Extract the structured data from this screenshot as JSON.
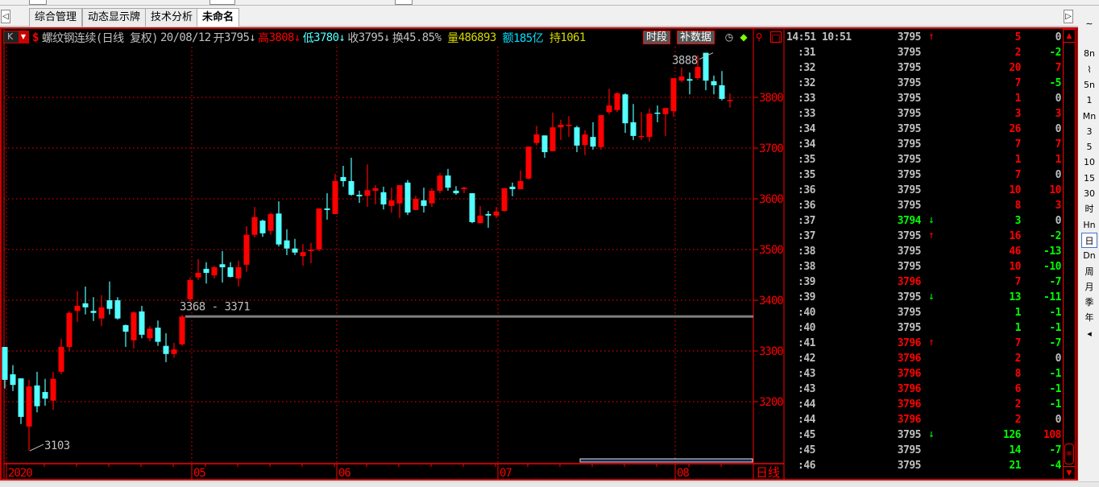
{
  "tabs": {
    "items": [
      {
        "label": "综合管理"
      },
      {
        "label": "动态显示牌"
      },
      {
        "label": "技术分析"
      },
      {
        "label": "未命名"
      }
    ],
    "active": 3
  },
  "header": {
    "period_button": "K",
    "name": "螺纹钢连续(日线 复权)",
    "date": "20/08/12",
    "open_label": "开",
    "open": "3795",
    "open_arrow": "↓",
    "high_label": "高",
    "high": "3808",
    "high_arrow": "↓",
    "low_label": "低",
    "low": "3780",
    "low_arrow": "↓",
    "close_label": "收",
    "close": "3795",
    "close_arrow": "↓",
    "turnover_label": "换",
    "turnover": "45.85%",
    "volume_label": "量",
    "volume": "486893",
    "amount_label": "额",
    "amount": "185亿",
    "oi_label": "持",
    "oi": "1061",
    "period_btn": "时段",
    "fill_btn": "补数据"
  },
  "colors": {
    "up": "#ff0000",
    "down": "#54ffff",
    "grid": "#ff0000",
    "green": "#00ff00",
    "text": "#c0c0c0"
  },
  "chart_data": {
    "type": "candlestick",
    "ylim": [
      3100,
      3900
    ],
    "yticks": [
      3200,
      3300,
      3400,
      3500,
      3600,
      3700,
      3800
    ],
    "period_label": "日线",
    "month_labels": [
      {
        "index": 0,
        "label": "2020"
      },
      {
        "index": 23,
        "label": "05"
      },
      {
        "index": 41,
        "label": "06"
      },
      {
        "index": 61,
        "label": "07"
      },
      {
        "index": 83,
        "label": "08"
      }
    ],
    "low_marker": {
      "index": 3,
      "value": 3103,
      "label": "3103"
    },
    "high_marker": {
      "index": 87,
      "value": 3888,
      "label": "3888"
    },
    "gap": {
      "from_index": 22,
      "low": 3368,
      "high": 3371,
      "label": "3368 - 3371"
    },
    "ohlc": [
      [
        3308,
        3308,
        3226,
        3243
      ],
      [
        3254,
        3272,
        3221,
        3233
      ],
      [
        3246,
        3246,
        3156,
        3170
      ],
      [
        3151,
        3243,
        3103,
        3230
      ],
      [
        3232,
        3259,
        3179,
        3191
      ],
      [
        3219,
        3245,
        3192,
        3206
      ],
      [
        3202,
        3259,
        3184,
        3245
      ],
      [
        3259,
        3324,
        3254,
        3308
      ],
      [
        3308,
        3378,
        3299,
        3375
      ],
      [
        3379,
        3418,
        3357,
        3389
      ],
      [
        3394,
        3427,
        3372,
        3386
      ],
      [
        3379,
        3406,
        3359,
        3375
      ],
      [
        3364,
        3410,
        3349,
        3386
      ],
      [
        3400,
        3437,
        3372,
        3383
      ],
      [
        3400,
        3406,
        3362,
        3364
      ],
      [
        3351,
        3352,
        3308,
        3338
      ],
      [
        3321,
        3378,
        3305,
        3376
      ],
      [
        3378,
        3389,
        3325,
        3332
      ],
      [
        3325,
        3349,
        3319,
        3344
      ],
      [
        3346,
        3360,
        3310,
        3318
      ],
      [
        3310,
        3335,
        3278,
        3294
      ],
      [
        3294,
        3316,
        3287,
        3303
      ],
      [
        3313,
        3371,
        3310,
        3368
      ],
      [
        3402,
        3445,
        3398,
        3440
      ],
      [
        3445,
        3481,
        3440,
        3454
      ],
      [
        3462,
        3475,
        3433,
        3454
      ],
      [
        3449,
        3468,
        3443,
        3465
      ],
      [
        3471,
        3497,
        3435,
        3465
      ],
      [
        3465,
        3475,
        3445,
        3446
      ],
      [
        3443,
        3478,
        3427,
        3465
      ],
      [
        3470,
        3546,
        3456,
        3529
      ],
      [
        3529,
        3584,
        3524,
        3564
      ],
      [
        3557,
        3559,
        3525,
        3532
      ],
      [
        3537,
        3573,
        3529,
        3570
      ],
      [
        3571,
        3595,
        3506,
        3510
      ],
      [
        3518,
        3540,
        3489,
        3502
      ],
      [
        3502,
        3521,
        3489,
        3494
      ],
      [
        3487,
        3511,
        3468,
        3495
      ],
      [
        3497,
        3513,
        3473,
        3500
      ],
      [
        3500,
        3581,
        3497,
        3581
      ],
      [
        3581,
        3611,
        3559,
        3578
      ],
      [
        3570,
        3649,
        3570,
        3635
      ],
      [
        3643,
        3665,
        3624,
        3635
      ],
      [
        3635,
        3681,
        3606,
        3608
      ],
      [
        3608,
        3616,
        3592,
        3605
      ],
      [
        3606,
        3668,
        3584,
        3617
      ],
      [
        3616,
        3627,
        3589,
        3621
      ],
      [
        3613,
        3624,
        3579,
        3589
      ],
      [
        3586,
        3622,
        3573,
        3597
      ],
      [
        3591,
        3627,
        3562,
        3627
      ],
      [
        3632,
        3637,
        3568,
        3573
      ],
      [
        3578,
        3606,
        3578,
        3600
      ],
      [
        3597,
        3622,
        3573,
        3586
      ],
      [
        3591,
        3621,
        3584,
        3616
      ],
      [
        3616,
        3651,
        3611,
        3646
      ],
      [
        3646,
        3659,
        3616,
        3622
      ],
      [
        3616,
        3625,
        3608,
        3611
      ],
      [
        3619,
        3624,
        3611,
        3622
      ],
      [
        3611,
        3611,
        3552,
        3554
      ],
      [
        3552,
        3586,
        3552,
        3567
      ],
      [
        3570,
        3576,
        3543,
        3567
      ],
      [
        3567,
        3584,
        3562,
        3575
      ],
      [
        3576,
        3621,
        3575,
        3621
      ],
      [
        3624,
        3632,
        3605,
        3619
      ],
      [
        3619,
        3656,
        3619,
        3635
      ],
      [
        3640,
        3703,
        3638,
        3703
      ],
      [
        3710,
        3744,
        3705,
        3727
      ],
      [
        3725,
        3725,
        3681,
        3692
      ],
      [
        3694,
        3770,
        3694,
        3741
      ],
      [
        3741,
        3756,
        3716,
        3746
      ],
      [
        3744,
        3763,
        3722,
        3746
      ],
      [
        3741,
        3744,
        3692,
        3705
      ],
      [
        3706,
        3735,
        3686,
        3727
      ],
      [
        3722,
        3751,
        3697,
        3703
      ],
      [
        3702,
        3765,
        3697,
        3765
      ],
      [
        3771,
        3817,
        3767,
        3784
      ],
      [
        3775,
        3810,
        3771,
        3808
      ],
      [
        3806,
        3808,
        3730,
        3749
      ],
      [
        3751,
        3787,
        3716,
        3724
      ],
      [
        3722,
        3771,
        3716,
        3724
      ],
      [
        3722,
        3778,
        3713,
        3768
      ],
      [
        3770,
        3784,
        3751,
        3768
      ],
      [
        3767,
        3779,
        3724,
        3779
      ],
      [
        3773,
        3838,
        3762,
        3838
      ],
      [
        3833,
        3859,
        3830,
        3841
      ],
      [
        3836,
        3849,
        3806,
        3833
      ],
      [
        3838,
        3883,
        3835,
        3860
      ],
      [
        3888,
        3888,
        3814,
        3833
      ],
      [
        3832,
        3843,
        3806,
        3824
      ],
      [
        3824,
        3852,
        3794,
        3797
      ],
      [
        3795,
        3808,
        3780,
        3795
      ]
    ]
  },
  "ticks": [
    {
      "time": "14:51 10:51",
      "price": "3795",
      "pc": "w",
      "arrow": "↑",
      "ac": "r",
      "vol": "5",
      "vc": "r",
      "chg": "0",
      "cc": "w"
    },
    {
      "time": ":31",
      "price": "3795",
      "pc": "w",
      "arrow": "",
      "ac": "",
      "vol": "2",
      "vc": "r",
      "chg": "-2",
      "cc": "g"
    },
    {
      "time": ":32",
      "price": "3795",
      "pc": "w",
      "arrow": "",
      "ac": "",
      "vol": "20",
      "vc": "r",
      "chg": "7",
      "cc": "r"
    },
    {
      "time": ":32",
      "price": "3795",
      "pc": "w",
      "arrow": "",
      "ac": "",
      "vol": "7",
      "vc": "r",
      "chg": "-5",
      "cc": "g"
    },
    {
      "time": ":33",
      "price": "3795",
      "pc": "w",
      "arrow": "",
      "ac": "",
      "vol": "1",
      "vc": "r",
      "chg": "0",
      "cc": "w"
    },
    {
      "time": ":33",
      "price": "3795",
      "pc": "w",
      "arrow": "",
      "ac": "",
      "vol": "3",
      "vc": "r",
      "chg": "3",
      "cc": "r"
    },
    {
      "time": ":34",
      "price": "3795",
      "pc": "w",
      "arrow": "",
      "ac": "",
      "vol": "26",
      "vc": "r",
      "chg": "0",
      "cc": "w"
    },
    {
      "time": ":34",
      "price": "3795",
      "pc": "w",
      "arrow": "",
      "ac": "",
      "vol": "7",
      "vc": "r",
      "chg": "7",
      "cc": "r"
    },
    {
      "time": ":35",
      "price": "3795",
      "pc": "w",
      "arrow": "",
      "ac": "",
      "vol": "1",
      "vc": "r",
      "chg": "1",
      "cc": "r"
    },
    {
      "time": ":35",
      "price": "3795",
      "pc": "w",
      "arrow": "",
      "ac": "",
      "vol": "7",
      "vc": "r",
      "chg": "0",
      "cc": "w"
    },
    {
      "time": ":36",
      "price": "3795",
      "pc": "w",
      "arrow": "",
      "ac": "",
      "vol": "10",
      "vc": "r",
      "chg": "10",
      "cc": "r"
    },
    {
      "time": ":36",
      "price": "3795",
      "pc": "w",
      "arrow": "",
      "ac": "",
      "vol": "8",
      "vc": "r",
      "chg": "3",
      "cc": "r"
    },
    {
      "time": ":37",
      "price": "3794",
      "pc": "g",
      "arrow": "↓",
      "ac": "g",
      "vol": "3",
      "vc": "g",
      "chg": "0",
      "cc": "w"
    },
    {
      "time": ":37",
      "price": "3795",
      "pc": "w",
      "arrow": "↑",
      "ac": "r",
      "vol": "16",
      "vc": "r",
      "chg": "-2",
      "cc": "g"
    },
    {
      "time": ":38",
      "price": "3795",
      "pc": "w",
      "arrow": "",
      "ac": "",
      "vol": "46",
      "vc": "r",
      "chg": "-13",
      "cc": "g"
    },
    {
      "time": ":38",
      "price": "3795",
      "pc": "w",
      "arrow": "",
      "ac": "",
      "vol": "10",
      "vc": "r",
      "chg": "-10",
      "cc": "g"
    },
    {
      "time": ":39",
      "price": "3796",
      "pc": "r",
      "arrow": "",
      "ac": "",
      "vol": "7",
      "vc": "r",
      "chg": "-7",
      "cc": "g"
    },
    {
      "time": ":39",
      "price": "3795",
      "pc": "w",
      "arrow": "↓",
      "ac": "g",
      "vol": "13",
      "vc": "g",
      "chg": "-11",
      "cc": "g"
    },
    {
      "time": ":40",
      "price": "3795",
      "pc": "w",
      "arrow": "",
      "ac": "",
      "vol": "1",
      "vc": "g",
      "chg": "-1",
      "cc": "g"
    },
    {
      "time": ":40",
      "price": "3795",
      "pc": "w",
      "arrow": "",
      "ac": "",
      "vol": "1",
      "vc": "g",
      "chg": "-1",
      "cc": "g"
    },
    {
      "time": ":41",
      "price": "3796",
      "pc": "r",
      "arrow": "↑",
      "ac": "r",
      "vol": "7",
      "vc": "r",
      "chg": "-7",
      "cc": "g"
    },
    {
      "time": ":42",
      "price": "3796",
      "pc": "r",
      "arrow": "",
      "ac": "",
      "vol": "2",
      "vc": "r",
      "chg": "0",
      "cc": "w"
    },
    {
      "time": ":43",
      "price": "3796",
      "pc": "r",
      "arrow": "",
      "ac": "",
      "vol": "8",
      "vc": "r",
      "chg": "-1",
      "cc": "g"
    },
    {
      "time": ":43",
      "price": "3796",
      "pc": "r",
      "arrow": "",
      "ac": "",
      "vol": "6",
      "vc": "r",
      "chg": "-1",
      "cc": "g"
    },
    {
      "time": ":44",
      "price": "3796",
      "pc": "r",
      "arrow": "",
      "ac": "",
      "vol": "2",
      "vc": "r",
      "chg": "-1",
      "cc": "g"
    },
    {
      "time": ":44",
      "price": "3796",
      "pc": "r",
      "arrow": "",
      "ac": "",
      "vol": "2",
      "vc": "r",
      "chg": "0",
      "cc": "w"
    },
    {
      "time": ":45",
      "price": "3795",
      "pc": "w",
      "arrow": "↓",
      "ac": "g",
      "vol": "126",
      "vc": "g",
      "chg": "108",
      "cc": "r"
    },
    {
      "time": ":45",
      "price": "3795",
      "pc": "w",
      "arrow": "",
      "ac": "",
      "vol": "14",
      "vc": "g",
      "chg": "-7",
      "cc": "g"
    },
    {
      "time": ":46",
      "price": "3795",
      "pc": "w",
      "arrow": "",
      "ac": "",
      "vol": "21",
      "vc": "g",
      "chg": "-4",
      "cc": "g"
    }
  ],
  "toolbar": [
    "∼",
    "8n",
    "⌇",
    "5n",
    "1",
    "Mn",
    "3",
    "5",
    "10",
    "15",
    "30",
    "时",
    "Hn",
    "日",
    "Dn",
    "周",
    "月",
    "季",
    "年",
    "◂"
  ],
  "toolbar_selected": 13
}
